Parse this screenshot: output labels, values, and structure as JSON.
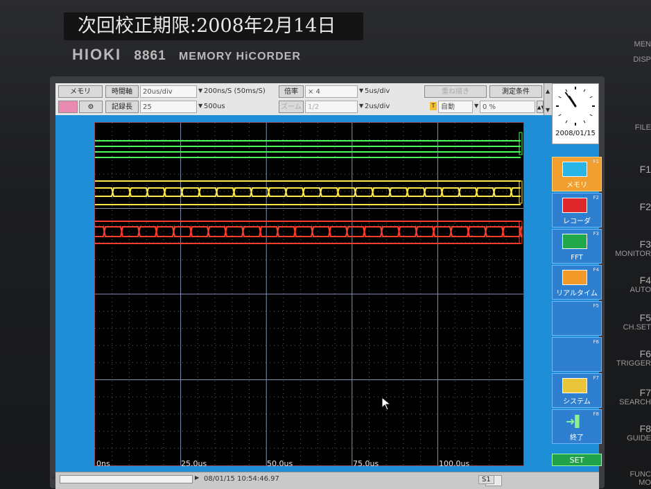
{
  "sticker": {
    "text": "次回校正期限:2008年2月14日"
  },
  "brand": {
    "logo": "HIOKI",
    "model": "8861",
    "product": "MEMORY HiCORDER"
  },
  "bezel_labels": {
    "top": [
      "MEN",
      "DISP",
      "FILE"
    ],
    "fkeys": [
      "F1",
      "F2",
      "F3",
      "F4",
      "F5",
      "F6",
      "F7",
      "F8"
    ],
    "sub": [
      "",
      "",
      "MONITOR",
      "AUTO",
      "CH.SET",
      "TRIGGER",
      "SEARCH",
      "GUIDE"
    ],
    "bottom": "FUNC",
    "bottom2": "MO"
  },
  "toolbar": {
    "memory_button": "メモリ",
    "time_axis_label": "時間軸",
    "time_axis_value": "20us/div",
    "sampling": "200ns/S (50ms/S)",
    "magnification_label": "倍率",
    "magnification_value": "× 4",
    "magnification_result": "5us/div",
    "overlay_label": "重ね描き",
    "measurement_conditions": "測定条件",
    "recording_label": "記録長",
    "recording_value": "25",
    "recording_time": "500us",
    "zoom_label": "ズーム",
    "zoom_value": "1/2",
    "zoom_result": "2us/div",
    "auto_value": "自動",
    "percent_value": "0 %"
  },
  "clock": {
    "date": "2008/01/15",
    "hour": 10,
    "minute": 54
  },
  "function_keys": [
    {
      "num": "F1",
      "label": "メモリ",
      "active": true
    },
    {
      "num": "F2",
      "label": "レコーダ",
      "active": false
    },
    {
      "num": "F3",
      "label": "FFT",
      "active": false
    },
    {
      "num": "F4",
      "label": "リアルタイム",
      "active": false
    },
    {
      "num": "F5",
      "label": "",
      "active": false
    },
    {
      "num": "F6",
      "label": "",
      "active": false
    },
    {
      "num": "F7",
      "label": "システム",
      "active": false
    },
    {
      "num": "F8",
      "label": "終了",
      "active": false
    }
  ],
  "set_button": "SET",
  "axis": {
    "x_ticks": [
      "0ns",
      "25.0us",
      "50.0us",
      "75.0us",
      "100.0us"
    ],
    "colors": {
      "ch_green": "#4dff5a",
      "ch_yellow": "#ffe84a",
      "ch_red": "#ff3c2a"
    }
  },
  "statusbar": {
    "timestamp": "08/01/15 10:54:46.97",
    "sheet": "S1"
  }
}
